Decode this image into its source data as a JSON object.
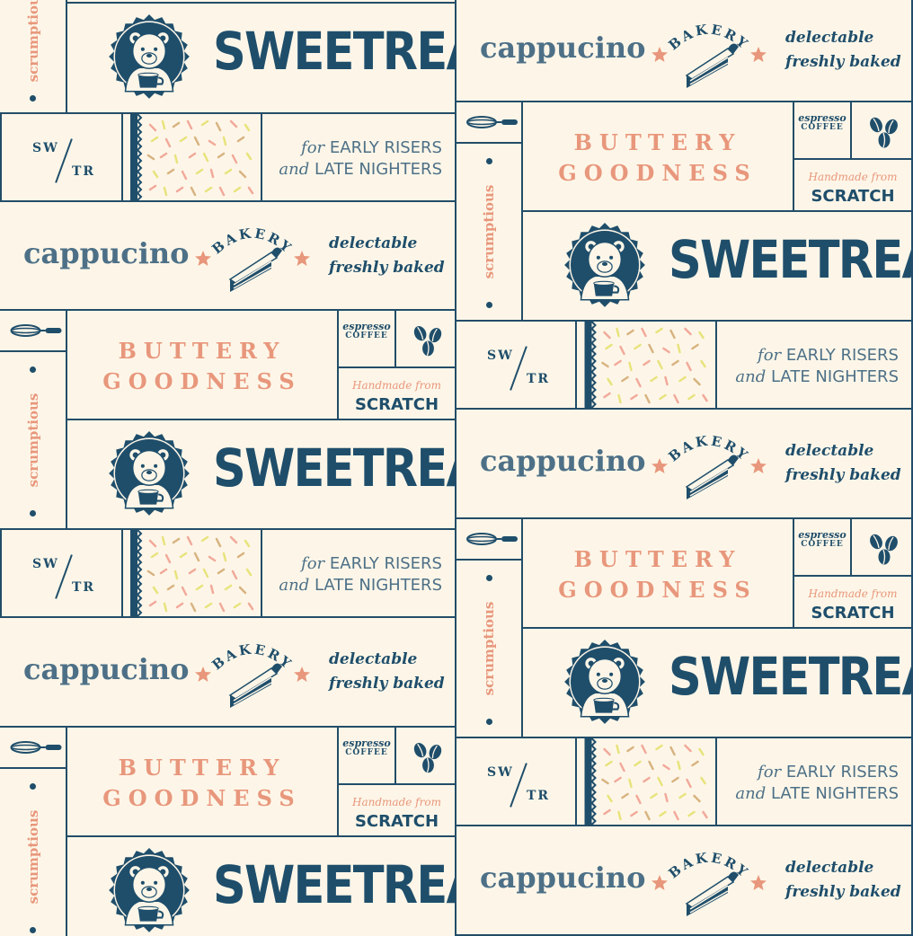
{
  "brand": {
    "name": "SWEETREAT"
  },
  "tagline": {
    "word": "scrumptious"
  },
  "coffee": {
    "name": "cappucino"
  },
  "bakery": {
    "label": "BAKERY"
  },
  "delectable": {
    "line1": "delectable",
    "line2": "freshly baked"
  },
  "buttery": {
    "line1": "BUTTERY",
    "line2": "GOODNESS"
  },
  "espresso": {
    "line1": "espresso",
    "line2": "COFFEE"
  },
  "handmade": {
    "line1": "Handmade from",
    "line2": "SCRATCH"
  },
  "monogram": {
    "top": "SW",
    "bottom": "TR"
  },
  "hours": {
    "for": "for",
    "line1": "EARLY RISERS",
    "and": "and",
    "line2": "LATE NIGHTERS"
  },
  "colors": {
    "navy": "#1f4e6b",
    "salmon": "#e8977c",
    "cream": "#fdf6e8",
    "steel": "#4d7087",
    "sprinkle_yellow": "#e8e37c",
    "sprinkle_pink": "#f2a99a",
    "sprinkle_tan": "#d8b380"
  }
}
